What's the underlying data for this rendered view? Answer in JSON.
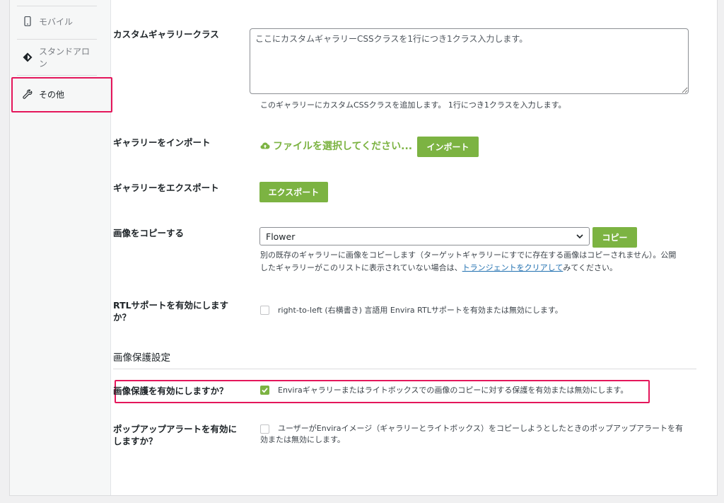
{
  "sidebar": {
    "items": [
      {
        "label": "モバイル",
        "icon": "mobile-icon"
      },
      {
        "label": "スタンドアロン",
        "icon": "standalone-icon"
      },
      {
        "label": "その他",
        "icon": "wrench-icon"
      }
    ]
  },
  "settings": {
    "custom_class": {
      "label": "カスタムギャラリークラス",
      "placeholder": "ここにカスタムギャラリーCSSクラスを1行につき1クラス入力します。",
      "description": "このギャラリーにカスタムCSSクラスを追加します。 1行につき1クラスを入力します。"
    },
    "import": {
      "label": "ギャラリーをインポート",
      "file_link": "ファイルを選択してください...",
      "button": "インポート"
    },
    "export": {
      "label": "ギャラリーをエクスポート",
      "button": "エクスポート"
    },
    "copy": {
      "label": "画像をコピーする",
      "selected": "Flower",
      "button": "コピー",
      "description_1": "別の既存のギャラリーに画像をコピーします（ターゲットギャラリーにすでに存在する画像はコピーされません）。公開",
      "description_2_pre": "したギャラリーがこのリストに表示されていない場合は、",
      "description_2_link": "トランジェントをクリアして",
      "description_2_post": "みてください。"
    },
    "rtl": {
      "label_1": "RTLサポートを有効にします",
      "label_2": "か？",
      "description": "right-to-left (右横書き) 言語用 Envira RTLサポートを有効または無効にします。",
      "checked": false
    },
    "protection_section": {
      "title": "画像保護設定"
    },
    "protection": {
      "label": "画像保護を有効にしますか？",
      "description": "Enviraギャラリーまたはライトボックスでの画像のコピーに対する保護を有効または無効にします。",
      "checked": true
    },
    "popup": {
      "label_1": "ポップアップアラートを有効に",
      "label_2": "しますか？",
      "description_1": "ユーザーがEnviraイメージ（ギャラリーとライトボックス）をコピーしようとしたときのポップアップアラートを有",
      "description_2": "効または無効にします。",
      "checked": false
    }
  },
  "colors": {
    "accent_green": "#7cb342",
    "highlight": "#e4165b",
    "link": "#2271b1"
  }
}
